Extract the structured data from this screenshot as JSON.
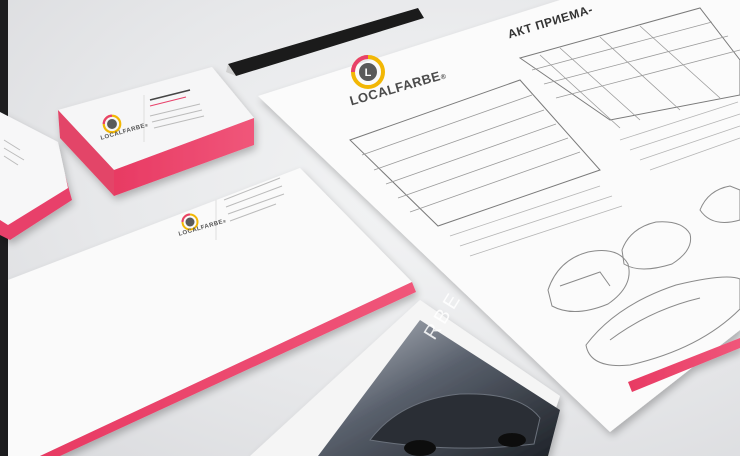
{
  "brand": {
    "name": "LOCALFARBE",
    "mark": "®",
    "accent_color": "#e8416b",
    "logo_ring_color": "#f2b705",
    "logo_inner_color": "#5a5a5a"
  },
  "document": {
    "title": "АКТ ПРИЕМА-"
  },
  "brochure": {
    "vertical_text": "RBE"
  },
  "icons": {
    "logo": "localfarbe-logo-icon",
    "pencil": "pencil-icon",
    "car": "car-outline-icon"
  }
}
